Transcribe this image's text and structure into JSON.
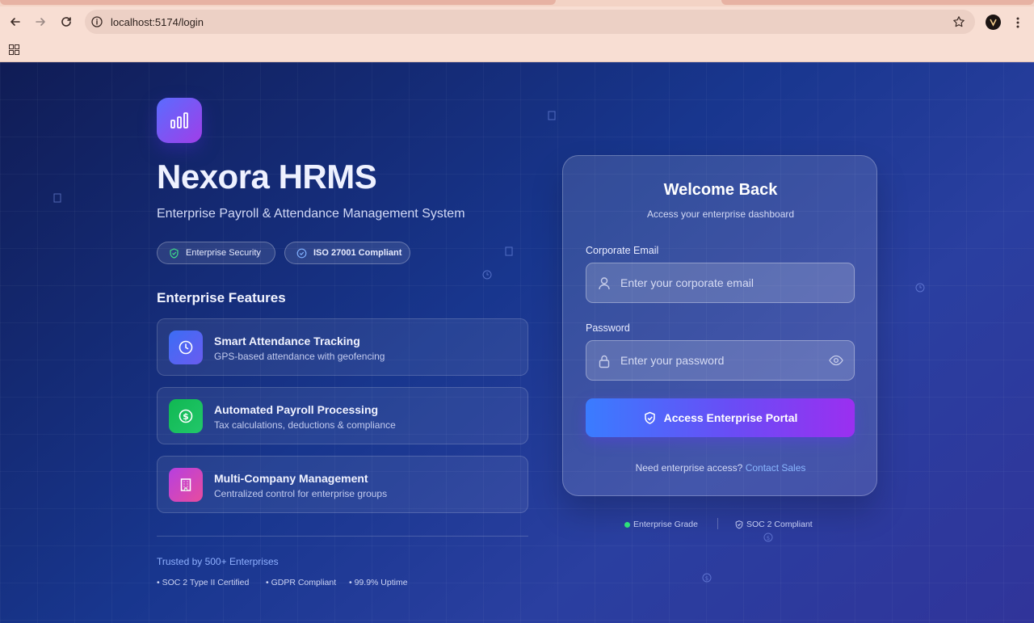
{
  "browser": {
    "url": "localhost:5174/login"
  },
  "brand": {
    "title": "Nexora HRMS",
    "subtitle": "Enterprise Payroll & Attendance Management System",
    "pills": [
      "Enterprise Security",
      "ISO 27001 Compliant"
    ]
  },
  "features": {
    "heading": "Enterprise Features",
    "items": [
      {
        "title": "Smart Attendance Tracking",
        "desc": "GPS-based attendance with geofencing",
        "icon": "clock-icon",
        "color": "#4f6cf5"
      },
      {
        "title": "Automated Payroll Processing",
        "desc": "Tax calculations, deductions & compliance",
        "icon": "dollar-icon",
        "color": "#18b85a"
      },
      {
        "title": "Multi-Company Management",
        "desc": "Centralized control for enterprise groups",
        "icon": "building-icon",
        "color": "#c940d8"
      }
    ]
  },
  "trust": {
    "headline": "Trusted by 500+ Enterprises",
    "certs": [
      "• SOC 2 Type II Certified",
      "• GDPR Compliant",
      "• 99.9% Uptime"
    ]
  },
  "login": {
    "title": "Welcome Back",
    "subtitle": "Access your enterprise dashboard",
    "email_label": "Corporate Email",
    "email_placeholder": "Enter your corporate email",
    "password_label": "Password",
    "password_placeholder": "Enter your password",
    "submit_label": "Access Enterprise Portal",
    "footer_text": "Need enterprise access?",
    "footer_link": "Contact Sales"
  },
  "badges": {
    "grade": "Enterprise Grade",
    "soc": "SOC 2 Compliant"
  },
  "colors": {
    "accent_start": "#3a7cff",
    "accent_end": "#9b2ff0",
    "status_green": "#2ee07a",
    "link": "#8ab7ff"
  }
}
